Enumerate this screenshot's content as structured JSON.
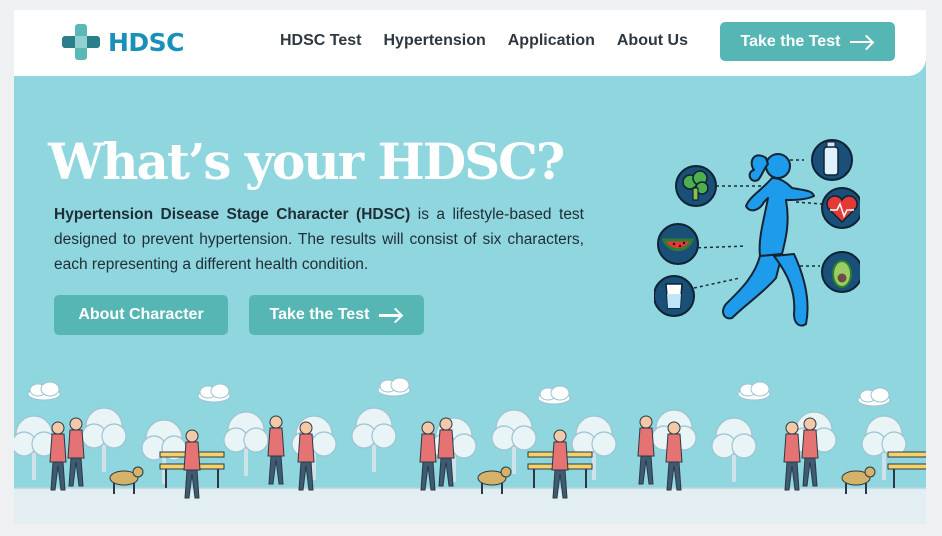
{
  "brand": {
    "name": "HDSC"
  },
  "nav": {
    "links": [
      "HDSC Test",
      "Hypertension",
      "Application",
      "About Us"
    ],
    "cta_label": "Take the Test"
  },
  "hero": {
    "title": "What’s your HDSC?",
    "desc_bold": "Hypertension Disease Stage Character (HDSC)",
    "desc_rest": " is a lifestyle-based test designed to prevent hypertension. The results will consist of six characters, each representing a different health condition.",
    "about_label": "About Character",
    "test_label": "Take the Test"
  },
  "colors": {
    "hero_bg": "#8fd6de",
    "accent": "#56b6b4",
    "brand_text": "#1a8fb8",
    "runner": "#1e9bea"
  },
  "illustration": {
    "health_icons": [
      "broccoli-icon",
      "watermelon-icon",
      "water-glass-icon",
      "water-bottle-icon",
      "heartbeat-icon",
      "avocado-icon"
    ]
  }
}
